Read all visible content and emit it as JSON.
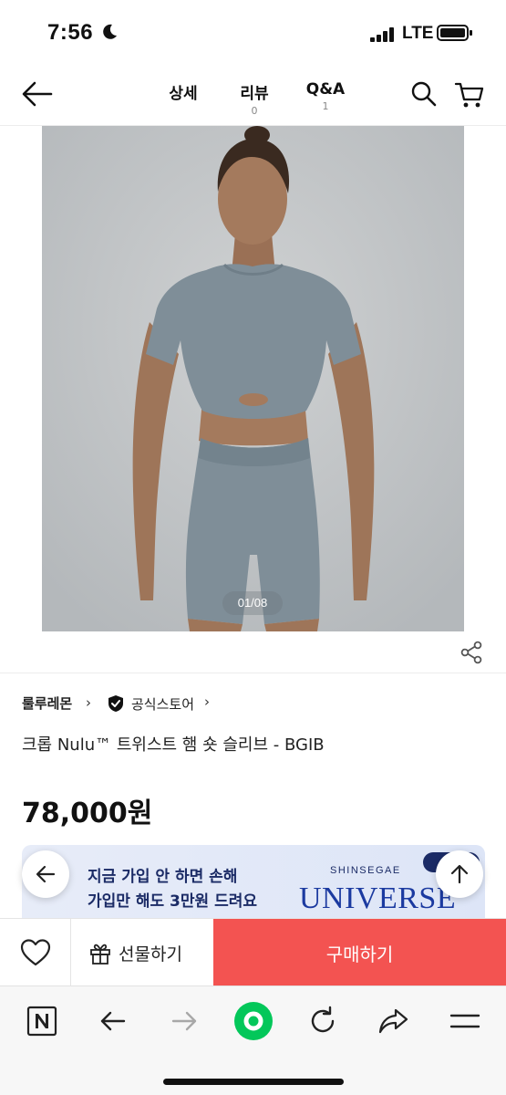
{
  "status_bar": {
    "time": "7:56",
    "network": "LTE",
    "icons": [
      "moon-icon",
      "signal-icon",
      "battery-icon"
    ]
  },
  "nav": {
    "back_icon": "back-arrow-icon",
    "tabs": [
      {
        "label": "상세",
        "count": ""
      },
      {
        "label": "리뷰",
        "count": "0"
      },
      {
        "label": "Q&A",
        "count": "1"
      }
    ],
    "search_icon": "search-icon",
    "cart_icon": "cart-icon"
  },
  "gallery": {
    "counter": "01/08",
    "share_icon": "share-icon"
  },
  "store": {
    "brand": "룰루레몬",
    "official_label": "공식스토어",
    "badge_icon": "shield-check-icon"
  },
  "product": {
    "title": "크롭 Nulu™ 트위스트 햄 숏 슬리브 - BGIB",
    "price": "78,000원"
  },
  "banner": {
    "line1": "지금 가입 안 하면 손해",
    "line2": "가입만 해도 3만원 드려요",
    "brand_small": "SHINSEGAE",
    "brand_big": "UNIVERSE"
  },
  "floating": {
    "back_icon": "arrow-left-icon",
    "top_icon": "arrow-up-icon"
  },
  "purchase": {
    "wish_icon": "heart-icon",
    "gift_icon": "gift-icon",
    "gift_label": "선물하기",
    "buy_label": "구매하기",
    "buy_color": "#f35351"
  },
  "browser": {
    "icons": [
      "naver-home-icon",
      "browser-back-icon",
      "browser-forward-icon",
      "green-dot-icon",
      "reload-icon",
      "share-forward-icon",
      "menu-icon"
    ],
    "accent": "#03c75a"
  }
}
